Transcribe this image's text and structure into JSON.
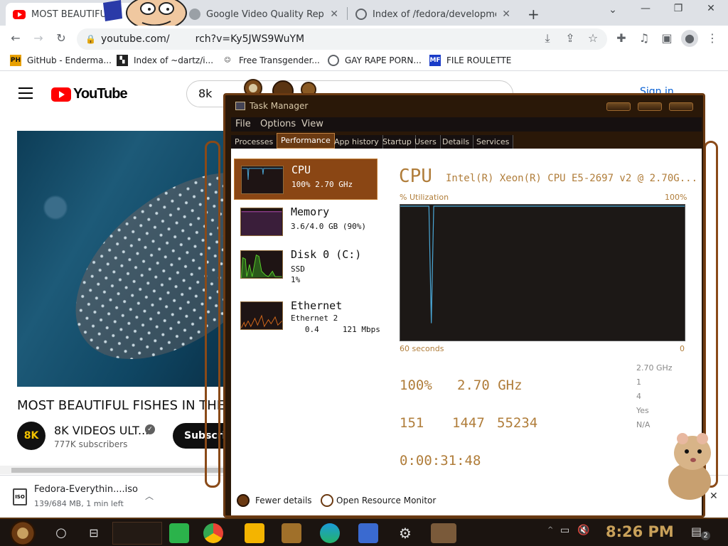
{
  "browser": {
    "tabs": [
      {
        "title": "MOST BEAUTIFU",
        "favicon": "youtube-icon",
        "active": true
      },
      {
        "title": "Google Video Quality Report",
        "favicon": "google-icon",
        "active": false
      },
      {
        "title": "Index of /fedora/development",
        "favicon": "globe-icon",
        "active": false
      }
    ],
    "new_tab_symbol": "+",
    "url_visible": "youtube.com/",
    "url_tail": "rch?v=Ky5JWS9WuYM"
  },
  "bookmarks": [
    {
      "label": "GitHub - Enderma...",
      "icon": "ph-icon"
    },
    {
      "label": "Index of ~dartz/i...",
      "icon": "terminal-icon"
    },
    {
      "label": "Free Transgender...",
      "icon": "mask-icon"
    },
    {
      "label": "GAY RAPE PORN...",
      "icon": "globe-icon"
    },
    {
      "label": "FILE ROULETTE",
      "icon": "roulette-icon"
    }
  ],
  "youtube": {
    "logo_text": "YouTube",
    "search_value": "8k",
    "sign_in": "Sign in",
    "video_title": "MOST BEAUTIFUL FISHES IN THE",
    "channel_name": "8K VIDEOS ULT...",
    "channel_avatar_text": "8K",
    "subscribers": "777K subscribers",
    "subscribe_label": "Subscri"
  },
  "download": {
    "filename": "Fedora-Everythin....iso",
    "status": "139/684 MB, 1 min left",
    "icon_text": "ISO"
  },
  "task_manager": {
    "title": "Task Manager",
    "menu": [
      "File",
      "Options",
      "View"
    ],
    "tabs": [
      "Processes",
      "Performance",
      "App history",
      "Startup",
      "Users",
      "Details",
      "Services"
    ],
    "active_tab": "Performance",
    "sidebar": [
      {
        "name": "CPU",
        "line1": "100%  2.70 GHz",
        "line2": ""
      },
      {
        "name": "Memory",
        "line1": "3.6/4.0 GB (90%)",
        "line2": ""
      },
      {
        "name": "Disk 0 (C:)",
        "line1": "SSD",
        "line2": "1%"
      },
      {
        "name": "Ethernet",
        "line1": "Ethernet 2",
        "line2": "   0.4     121 Mbps"
      }
    ],
    "cpu_heading": "CPU",
    "cpu_model": "Intel(R) Xeon(R) CPU E5-2697 v2 @ 2.70G...",
    "graph_label_left": "% Utilization",
    "graph_label_right": "100%",
    "axis_left": "60 seconds",
    "axis_right": "0",
    "utilization": "100%",
    "speed": "2.70 GHz",
    "processes": "151",
    "threads": "1447",
    "handles": "55234",
    "uptime": "0:00:31:48",
    "specs": [
      "2.70 GHz",
      "1",
      "4",
      "Yes",
      "N/A"
    ],
    "fewer_details": "Fewer details",
    "open_resource_monitor": "Open Resource Monitor",
    "cpu_history": [
      100,
      100,
      100,
      100,
      100,
      100,
      100,
      100,
      100,
      100,
      100,
      100,
      100,
      12,
      100,
      100,
      100,
      100,
      100,
      100,
      100,
      100,
      100,
      100,
      100,
      100,
      100,
      100,
      100,
      100,
      100,
      100,
      100,
      100,
      100,
      100,
      100,
      100,
      100,
      100,
      100,
      100,
      100,
      100,
      100,
      100,
      100,
      100,
      100,
      100,
      100,
      100,
      100,
      100,
      100,
      100,
      100,
      100,
      100,
      100,
      100,
      100,
      100,
      100,
      100,
      100,
      100,
      100,
      100,
      100,
      100,
      100,
      100,
      100,
      100,
      100,
      100,
      100,
      100,
      100,
      100,
      100,
      100,
      100,
      100,
      100,
      100,
      100,
      100,
      100,
      100,
      100,
      100,
      100,
      100,
      100,
      100,
      100,
      100,
      100,
      100,
      100,
      100,
      100,
      100,
      100,
      100,
      100,
      100,
      100,
      100,
      100,
      100,
      100,
      100,
      100,
      100,
      100,
      100,
      100
    ]
  },
  "taskbar": {
    "clock": "8:26 PM",
    "notification_count": "2"
  },
  "colors": {
    "accent_copper": "#b07d3a",
    "task_manager_frame": "#6b3a12",
    "youtube_red": "#ff0000"
  }
}
